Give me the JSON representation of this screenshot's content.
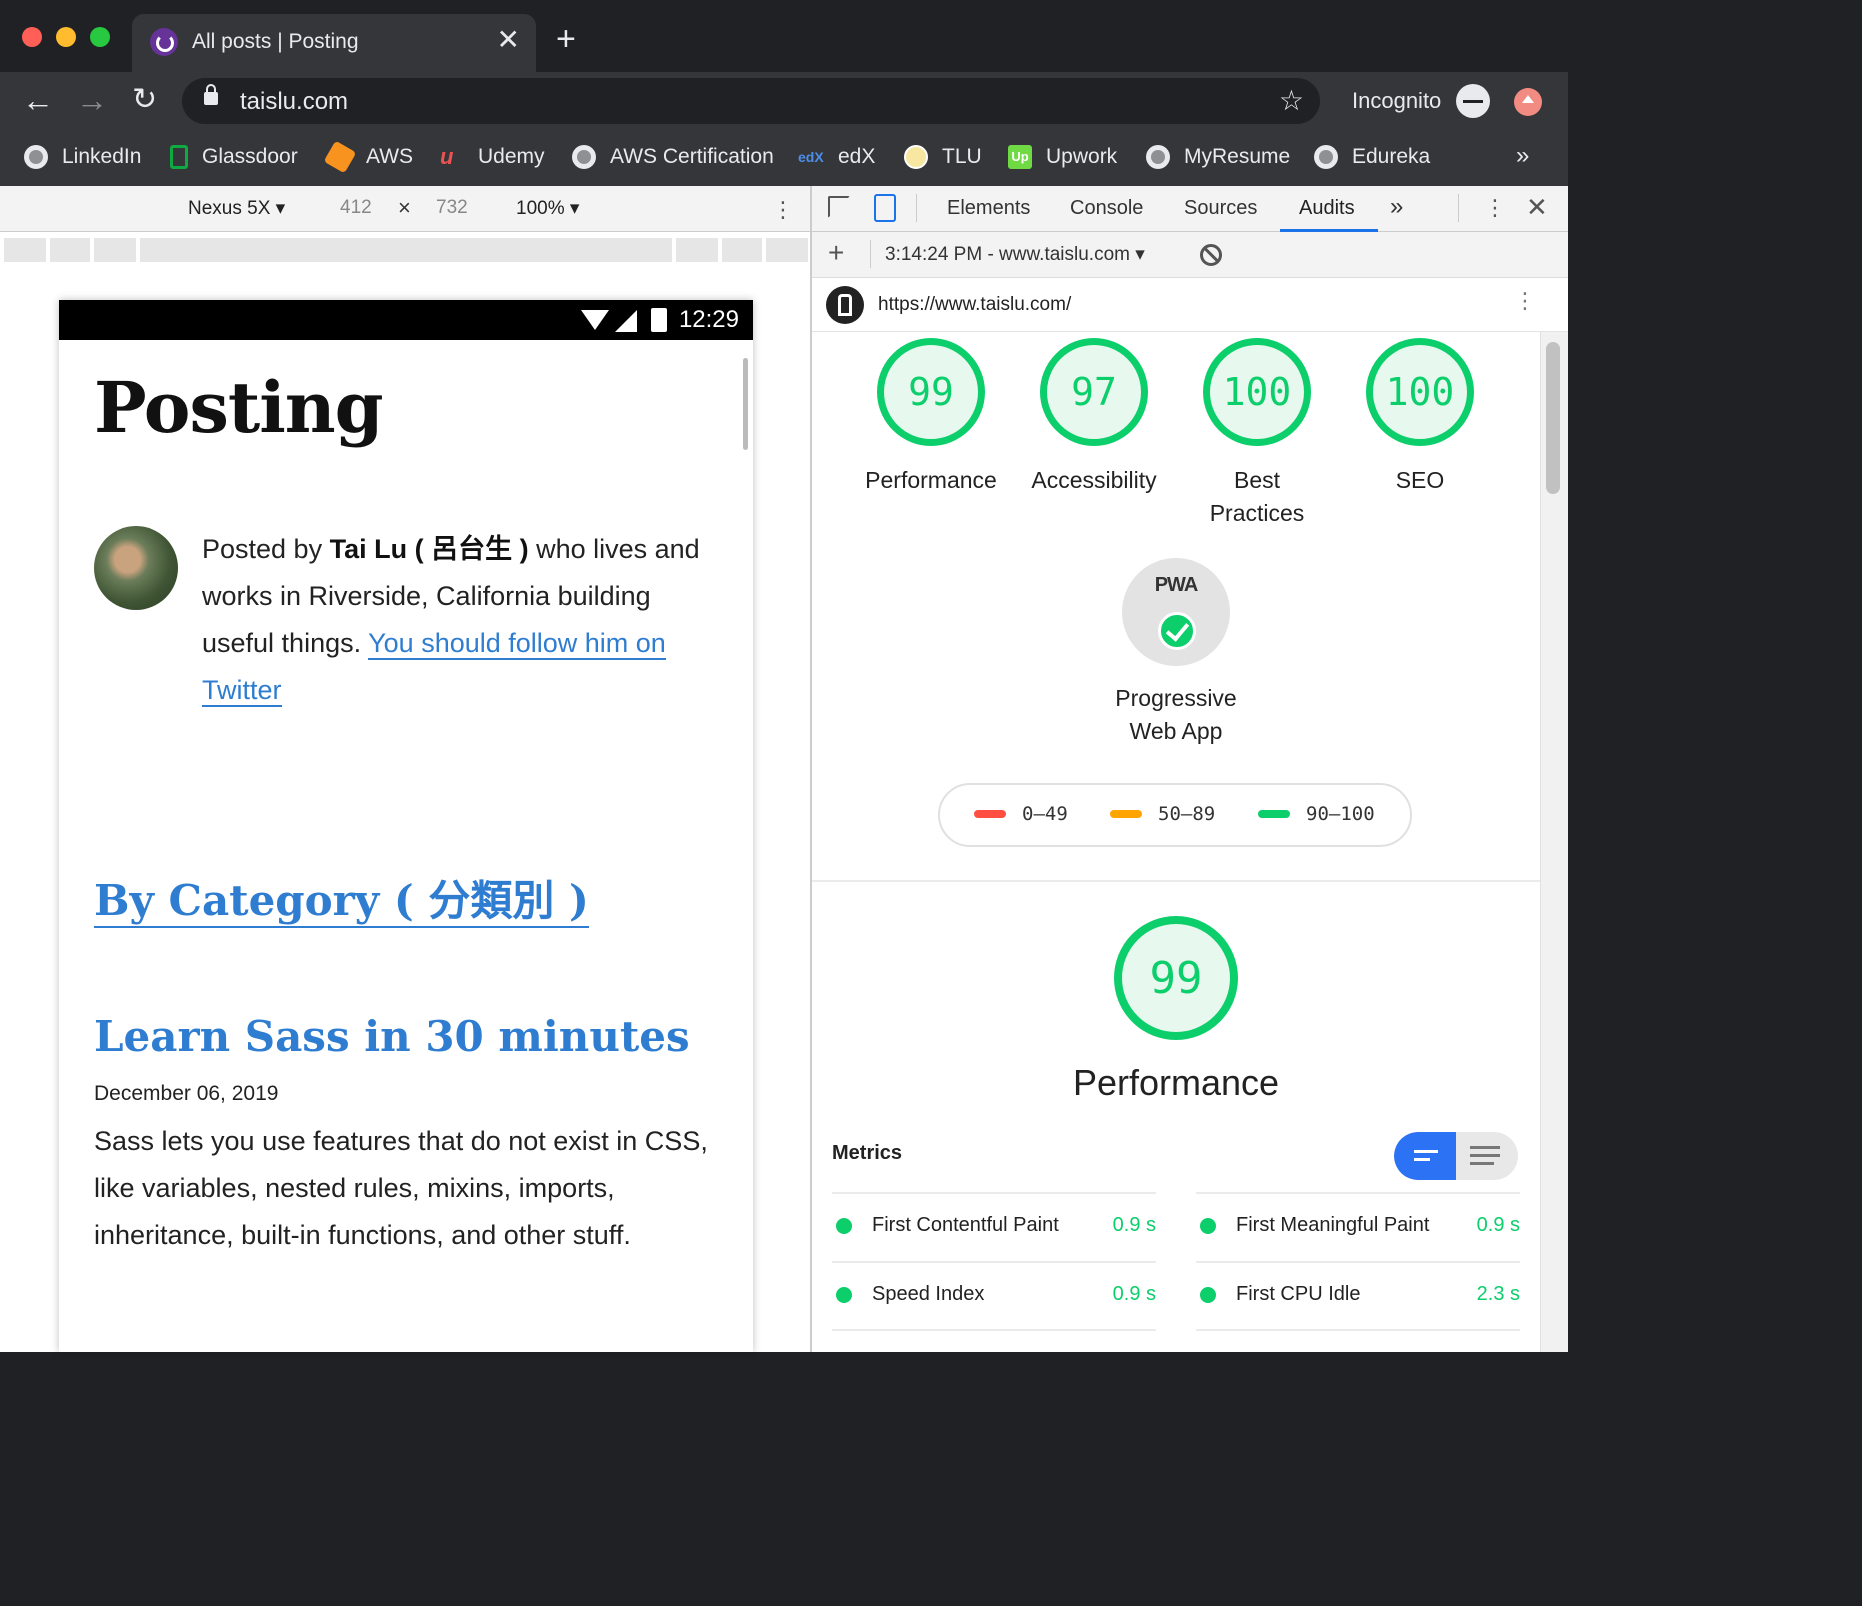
{
  "browser": {
    "tab_title": "All posts | Posting",
    "tab_close": "✕",
    "new_tab": "+",
    "url": "taislu.com",
    "profile_label": "Incognito",
    "bookmarks": [
      "LinkedIn",
      "Glassdoor",
      "AWS",
      "Udemy",
      "AWS Certification",
      "edX",
      "TLU",
      "Upwork",
      "MyResume",
      "Edureka"
    ],
    "bookmarks_more": "»"
  },
  "device_toolbar": {
    "device": "Nexus 5X",
    "width": "412",
    "times": "×",
    "height": "732",
    "zoom": "100%"
  },
  "phone": {
    "status_time": "12:29",
    "site_title": "Posting",
    "bio_prefix": "Posted by ",
    "bio_name": "Tai Lu ( 呂台生 )",
    "bio_suffix": " who lives and works in Riverside, California building useful things. ",
    "bio_link": "You should follow him on Twitter",
    "category_link": "By Category ( 分類別 )",
    "post_title": "Learn Sass in 30 minutes",
    "post_date": "December 06, 2019",
    "post_excerpt": "Sass lets you use features that do not exist in CSS, like variables, nested rules, mixins, imports, inheritance, built-in functions, and other stuff."
  },
  "devtools": {
    "tabs": [
      "Elements",
      "Console",
      "Sources",
      "Audits"
    ],
    "active_tab": "Audits",
    "tabs_more": "»",
    "audit_session": "3:14:24 PM - www.taislu.com",
    "report_url": "https://www.taislu.com/",
    "scores": [
      {
        "label_1": "Performance",
        "label_2": "",
        "score": "99"
      },
      {
        "label_1": "Accessibility",
        "label_2": "",
        "score": "97"
      },
      {
        "label_1": "Best",
        "label_2": "Practices",
        "score": "100"
      },
      {
        "label_1": "SEO",
        "label_2": "",
        "score": "100"
      }
    ],
    "pwa_badge": "PWA",
    "pwa_label_1": "Progressive",
    "pwa_label_2": "Web App",
    "legend": [
      "0–49",
      "50–89",
      "90–100"
    ],
    "perf_score": "99",
    "perf_title": "Performance",
    "metrics_label": "Metrics",
    "metrics": [
      {
        "name": "First Contentful Paint",
        "value": "0.9 s"
      },
      {
        "name": "First Meaningful Paint",
        "value": "0.9 s"
      },
      {
        "name": "Speed Index",
        "value": "0.9 s"
      },
      {
        "name": "First CPU Idle",
        "value": "2.3 s"
      }
    ]
  },
  "colors": {
    "pass": "#0cce6b",
    "average": "#ffa400",
    "fail": "#ff4e42",
    "link": "#2f7dd1",
    "accent": "#1a73e8"
  }
}
